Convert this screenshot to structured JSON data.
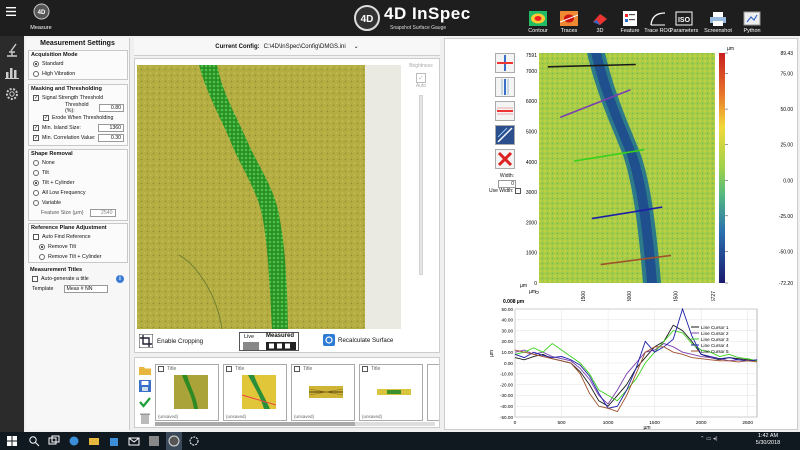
{
  "top": {
    "measure": "Measure",
    "logo_4d": "4D",
    "logo_text": "4D InSpec",
    "logo_sub": "Snapshot Surface Gauge",
    "buttons": [
      "Contour",
      "Traces",
      "3D",
      "Feature",
      "Trace ROC",
      "Parameters",
      "Screenshot",
      "Python"
    ]
  },
  "settings": {
    "title": "Measurement Settings",
    "acq_title": "Acquisition Mode",
    "acq_modes": [
      "Standard",
      "High Vibration"
    ],
    "mask_title": "Masking and Thresholding",
    "signal_strength": "Signal Strength Threshold",
    "threshold_label": "Threshold (%):",
    "threshold_value": "0.80",
    "erode": "Erode When Thresholding",
    "min_island": "Min. Island Size:",
    "min_island_value": "1360",
    "min_corr": "Min. Correlation Value:",
    "min_corr_value": "0.30",
    "shape_title": "Shape Removal",
    "shape_options": [
      "None",
      "Tilt",
      "Tilt + Cylinder",
      "All Low Frequency",
      "Variable"
    ],
    "feature_size": "Feature Size (µm)",
    "feature_size_value": "2540",
    "ref_title": "Reference Plane Adjustment",
    "auto_find": "Auto Find Reference",
    "ref_options": [
      "Remove Tilt",
      "Remove Tilt + Cylinder"
    ],
    "titles_title": "Measurement Titles",
    "auto_generate": "Auto-generate a title",
    "template_label": "Template",
    "template_value": "Meas # NN"
  },
  "center": {
    "config_label": "Current Config:",
    "config_path": "C:\\4D\\InSpec\\Config\\DMGS.ini",
    "brightness": "Brightness",
    "auto": "Auto",
    "enable_cropping": "Enable Cropping",
    "live": "Live",
    "measured": "Measured",
    "recalc": "Recalculate Surface",
    "thumbs": [
      {
        "title": "Title",
        "tag": "(unsaved)"
      },
      {
        "title": "Title",
        "tag": "(unsaved)"
      },
      {
        "title": "Title",
        "tag": "(unsaved)"
      },
      {
        "title": "Title",
        "tag": "(unsaved)"
      }
    ]
  },
  "right": {
    "width_label": "Width:",
    "width_value": "0",
    "use_width": "Use Width:",
    "map_y_ticks": [
      "7591",
      "7000",
      "6000",
      "5000",
      "4000",
      "3000",
      "2000",
      "1000",
      "0"
    ],
    "map_x_ticks": [
      "0",
      "1500",
      "3000",
      "4500",
      "5727"
    ],
    "map_x_unit": "µm",
    "map_y_unit": "µm",
    "colorbar_unit": "µm",
    "colorbar_ticks": [
      "89.43",
      "75.00",
      "50.00",
      "25.00",
      "0.00",
      "-25.00",
      "-50.00",
      "-72.20"
    ],
    "line_title": "0.008 µm",
    "legend": [
      "Line Cursor 1",
      "Line Cursor 2",
      "Line Cursor 3",
      "Line Cursor 4",
      "Line Cursor 5"
    ],
    "legend_colors": [
      "#1a1a1a",
      "#7b3fb0",
      "#39d11b",
      "#1e1ea8",
      "#a0522d"
    ]
  },
  "taskbar": {
    "time": "1:42 AM",
    "date": "5/30/2018"
  },
  "chart_data": {
    "type": "line",
    "title": "0.008 µm",
    "xlabel": "µm",
    "ylabel": "µm",
    "xlim": [
      0,
      2600
    ],
    "ylim": [
      -50,
      50
    ],
    "xticks": [
      0,
      500,
      1000,
      1500,
      2000,
      2500
    ],
    "yticks": [
      50,
      40,
      30,
      20,
      10,
      0,
      -10,
      -20,
      -30,
      -40,
      -50
    ],
    "x": [
      0,
      100,
      200,
      300,
      400,
      500,
      600,
      700,
      800,
      900,
      1000,
      1100,
      1200,
      1300,
      1400,
      1500,
      1600,
      1700,
      1800,
      1900,
      2000,
      2100,
      2200,
      2300,
      2400,
      2500,
      2600
    ],
    "series": [
      {
        "name": "Line Cursor 1",
        "color": "#1a1a1a",
        "values": [
          5,
          3,
          6,
          8,
          4,
          2,
          0,
          -8,
          -20,
          -35,
          -40,
          -30,
          -20,
          -5,
          5,
          15,
          20,
          35,
          30,
          20,
          8,
          5,
          3,
          5,
          4,
          3,
          2
        ]
      },
      {
        "name": "Line Cursor 2",
        "color": "#7b3fb0",
        "values": [
          10,
          12,
          8,
          10,
          6,
          4,
          2,
          -5,
          -15,
          -30,
          -38,
          -25,
          -10,
          0,
          10,
          12,
          18,
          15,
          10,
          8,
          6,
          5,
          4,
          2,
          3,
          2,
          3
        ]
      },
      {
        "name": "Line Cursor 3",
        "color": "#39d11b",
        "values": [
          8,
          10,
          14,
          10,
          18,
          12,
          6,
          0,
          -10,
          -25,
          -30,
          -35,
          -25,
          -15,
          0,
          10,
          20,
          30,
          28,
          18,
          12,
          10,
          6,
          8,
          5,
          4,
          2
        ]
      },
      {
        "name": "Line Cursor 4",
        "color": "#1e1ea8",
        "values": [
          8,
          5,
          10,
          7,
          5,
          6,
          3,
          -2,
          -12,
          -28,
          -42,
          -40,
          -25,
          -5,
          20,
          10,
          15,
          22,
          50,
          25,
          8,
          6,
          4,
          5,
          3,
          2,
          3
        ]
      },
      {
        "name": "Line Cursor 5",
        "color": "#a0522d",
        "values": [
          12,
          10,
          8,
          6,
          4,
          2,
          0,
          -10,
          -28,
          -40,
          -42,
          -45,
          -30,
          -10,
          10,
          15,
          15,
          10,
          8,
          5,
          4,
          3,
          2,
          2,
          1,
          2,
          1
        ]
      }
    ]
  }
}
